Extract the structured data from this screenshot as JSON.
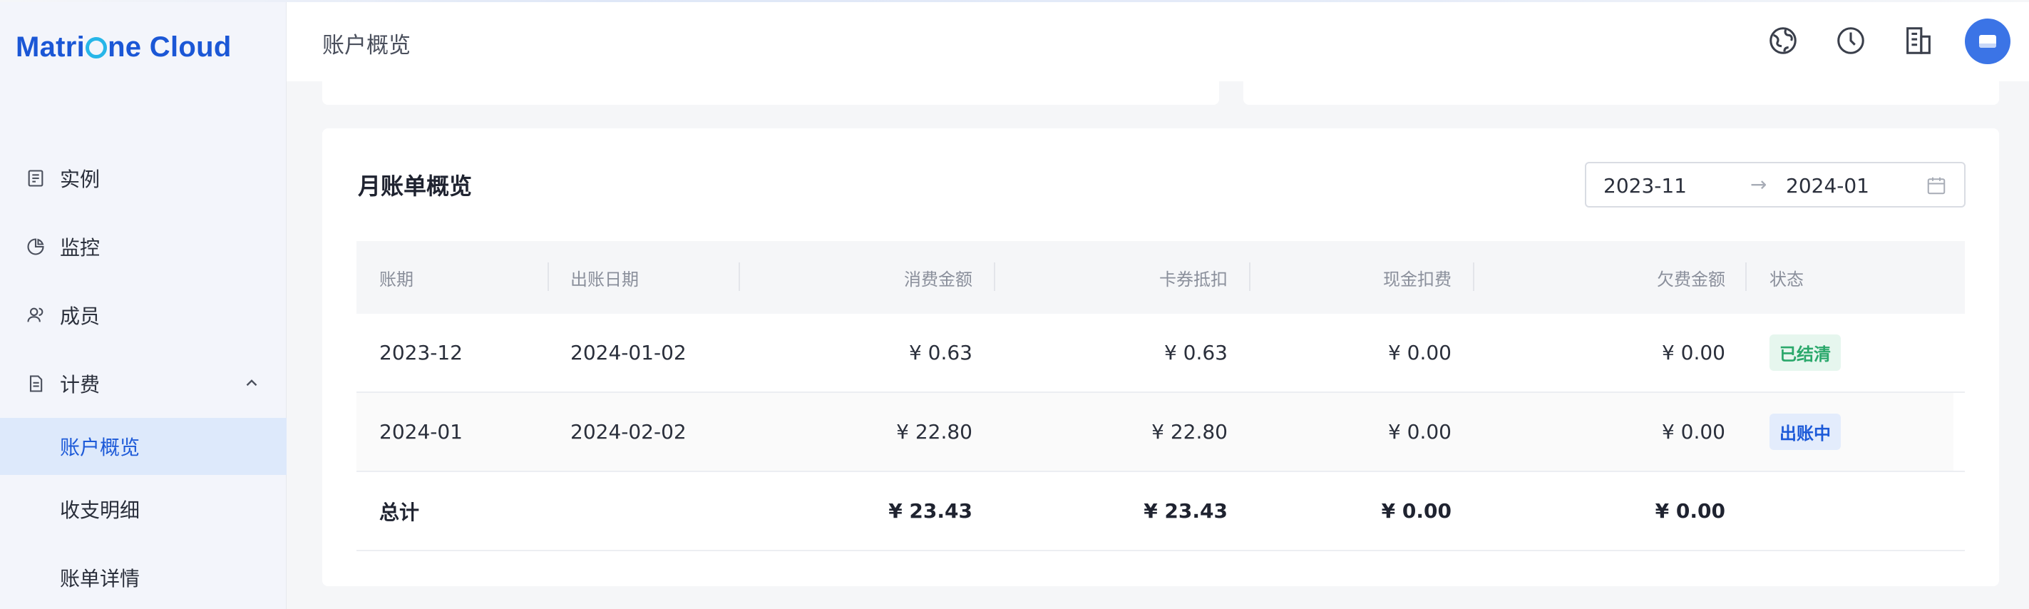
{
  "app": {
    "logo_left": "Matri",
    "logo_right": "ne Cloud"
  },
  "sidebar": {
    "items": [
      {
        "label": "实例",
        "icon": "instance-icon"
      },
      {
        "label": "监控",
        "icon": "pie-chart-icon"
      },
      {
        "label": "成员",
        "icon": "members-icon"
      },
      {
        "label": "计费",
        "icon": "billing-icon",
        "expanded": true
      }
    ],
    "sub_items": [
      {
        "label": "账户概览",
        "active": true
      },
      {
        "label": "收支明细",
        "active": false
      },
      {
        "label": "账单详情",
        "active": false
      }
    ]
  },
  "header": {
    "title": "账户概览",
    "icons": [
      "globe-icon",
      "clock-icon",
      "building-icon",
      "avatar"
    ]
  },
  "monthly_bill": {
    "title": "月账单概览",
    "range_start": "2023-11",
    "range_arrow": "→",
    "range_end": "2024-01",
    "columns": [
      "账期",
      "出账日期",
      "消费金额",
      "卡券抵扣",
      "现金扣费",
      "欠费金额",
      "状态"
    ],
    "rows": [
      {
        "period": "2023-12",
        "date": "2024-01-02",
        "spend": "¥ 0.63",
        "coupon": "¥ 0.63",
        "cash": "¥ 0.00",
        "arrears": "¥ 0.00",
        "status": "已结清"
      },
      {
        "period": "2024-01",
        "date": "2024-02-02",
        "spend": "¥ 22.80",
        "coupon": "¥ 22.80",
        "cash": "¥ 0.00",
        "arrears": "¥ 0.00",
        "status": "出账中"
      }
    ],
    "total": {
      "label": "总计",
      "spend": "¥ 23.43",
      "coupon": "¥ 23.43",
      "cash": "¥ 0.00",
      "arrears": "¥ 0.00"
    }
  },
  "colors": {
    "brand": "#1b57d6",
    "accent_ring": "#27b6e8",
    "active_bg": "#dde9fb",
    "status_settled": "#2aa86b",
    "status_billing": "#1d5ad8"
  }
}
